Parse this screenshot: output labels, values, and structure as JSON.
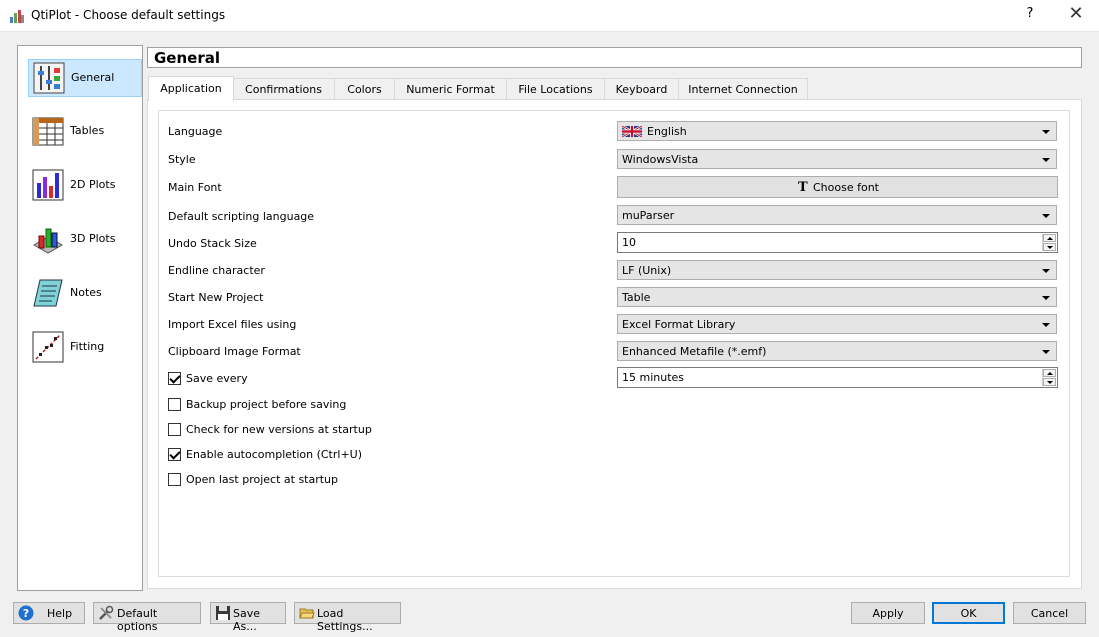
{
  "window": {
    "title": "QtiPlot - Choose default settings",
    "help_glyph": "?",
    "close_glyph": "✕"
  },
  "sidebar": {
    "items": [
      {
        "label": "General",
        "icon": "general-settings-icon",
        "selected": true
      },
      {
        "label": "Tables",
        "icon": "table-icon",
        "selected": false
      },
      {
        "label": "2D Plots",
        "icon": "bar-chart-2d-icon",
        "selected": false
      },
      {
        "label": "3D Plots",
        "icon": "bar-chart-3d-icon",
        "selected": false
      },
      {
        "label": "Notes",
        "icon": "notes-icon",
        "selected": false
      },
      {
        "label": "Fitting",
        "icon": "fitting-icon",
        "selected": false
      }
    ]
  },
  "panel": {
    "title": "General"
  },
  "tabs": [
    {
      "label": "Application",
      "active": true
    },
    {
      "label": "Confirmations",
      "active": false
    },
    {
      "label": "Colors",
      "active": false
    },
    {
      "label": "Numeric Format",
      "active": false
    },
    {
      "label": "File Locations",
      "active": false
    },
    {
      "label": "Keyboard",
      "active": false
    },
    {
      "label": "Internet Connection",
      "active": false
    }
  ],
  "fields": {
    "language": {
      "label": "Language",
      "value": "English",
      "icon": "uk-flag-icon"
    },
    "style": {
      "label": "Style",
      "value": "WindowsVista"
    },
    "main_font": {
      "label": "Main Font",
      "button": "Choose font",
      "icon_glyph": "T"
    },
    "scripting": {
      "label": "Default scripting language",
      "value": "muParser"
    },
    "undo_stack": {
      "label": "Undo Stack Size",
      "value": "10"
    },
    "endline": {
      "label": "Endline character",
      "value": "LF (Unix)"
    },
    "start_project": {
      "label": "Start New Project",
      "value": "Table"
    },
    "import_excel": {
      "label": "Import Excel files using",
      "value": "Excel Format Library"
    },
    "clipboard_format": {
      "label": "Clipboard Image Format",
      "value": "Enhanced Metafile (*.emf)"
    },
    "save_every": {
      "label": "Save every",
      "checked": true,
      "value": "15 minutes"
    }
  },
  "checkboxes": [
    {
      "label": "Backup project before saving",
      "checked": false
    },
    {
      "label": "Check for new versions at startup",
      "checked": false
    },
    {
      "label": "Enable autocompletion (Ctrl+U)",
      "checked": true
    },
    {
      "label": "Open last project at startup",
      "checked": false
    }
  ],
  "buttons": {
    "help": "Help",
    "default_options": "Default options",
    "save_as": "Save As...",
    "load_settings": "Load Settings...",
    "apply": "Apply",
    "ok": "OK",
    "cancel": "Cancel"
  },
  "colors": {
    "selection": "#cce8ff",
    "ok_border": "#0078d7"
  }
}
